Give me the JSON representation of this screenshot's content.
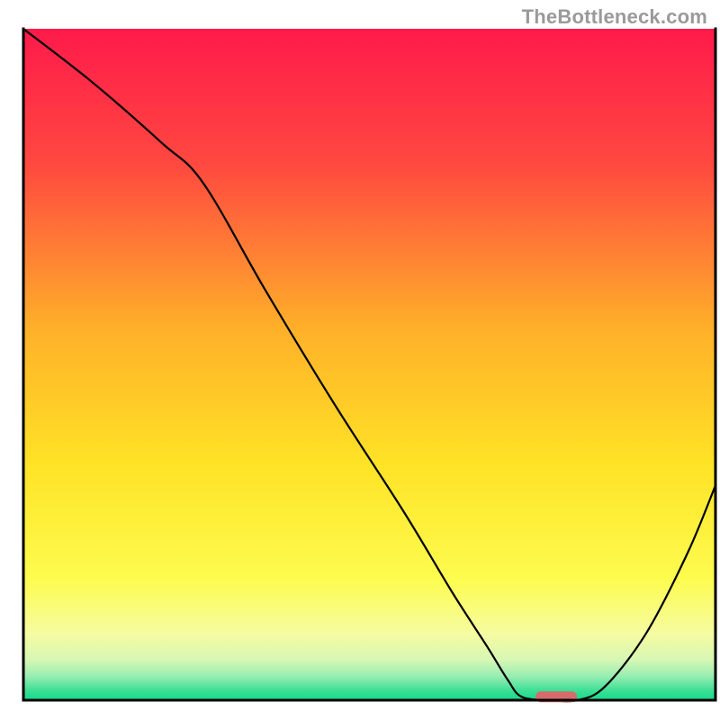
{
  "watermark": "TheBottleneck.com",
  "chart_data": {
    "type": "line",
    "title": "",
    "xlabel": "",
    "ylabel": "",
    "xlim": [
      0,
      100
    ],
    "ylim": [
      0,
      100
    ],
    "grid": false,
    "legend": false,
    "annotations": [],
    "background_gradient": {
      "stops": [
        {
          "offset": 0.0,
          "color": "#ff1a4b"
        },
        {
          "offset": 0.2,
          "color": "#ff4840"
        },
        {
          "offset": 0.45,
          "color": "#ffb129"
        },
        {
          "offset": 0.65,
          "color": "#ffe326"
        },
        {
          "offset": 0.82,
          "color": "#fdfc4f"
        },
        {
          "offset": 0.9,
          "color": "#f6fca0"
        },
        {
          "offset": 0.94,
          "color": "#d7f7b4"
        },
        {
          "offset": 0.965,
          "color": "#96edb1"
        },
        {
          "offset": 0.985,
          "color": "#3fdf96"
        },
        {
          "offset": 1.0,
          "color": "#14d98a"
        }
      ]
    },
    "series": [
      {
        "name": "bottleneck-curve",
        "color": "#000000",
        "x": [
          0,
          10,
          20,
          26,
          35,
          45,
          55,
          62,
          67,
          70,
          72,
          76,
          80,
          84,
          90,
          96,
          100
        ],
        "values": [
          100,
          92,
          83,
          77,
          61,
          44,
          28,
          16,
          8,
          3,
          0.5,
          0,
          0,
          2,
          10,
          22,
          32
        ]
      }
    ],
    "marker": {
      "name": "optimal-range-marker",
      "color": "#d66b6b",
      "x_start": 74,
      "x_end": 80,
      "y": 0.5,
      "height": 1.6
    },
    "axes": {
      "color": "#000000",
      "line_width": 3
    }
  }
}
